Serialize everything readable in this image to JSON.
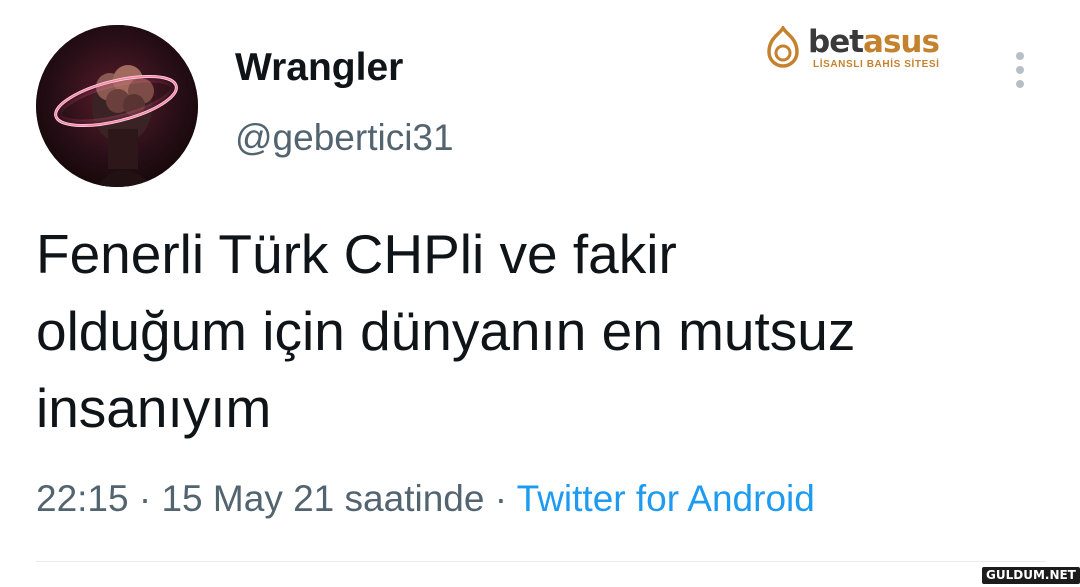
{
  "user": {
    "display_name": "Wrangler",
    "handle": "@gebertici31"
  },
  "tweet": {
    "lines": [
      "Fenerli Türk CHPli ve fakir",
      "olduğum için dünyanın en mutsuz",
      "insanıyım"
    ],
    "time": "22:15",
    "separator": " · ",
    "date": "15 May 21 saatinde",
    "source": "Twitter for Android"
  },
  "watermark": {
    "brand_a": "bet",
    "brand_b": "asus",
    "subtitle": "LİSANSLI BAHİS SİTESİ",
    "site_badge": "GULDUM.NET"
  },
  "icons": {
    "more": "more-vertical-icon",
    "brand_logo": "betasus-logo-icon"
  },
  "colors": {
    "text_primary": "#0f1419",
    "text_secondary": "#536471",
    "link": "#1d9bf0",
    "brand_gold": "#c4822f",
    "brand_dark": "#3a3a3a"
  }
}
